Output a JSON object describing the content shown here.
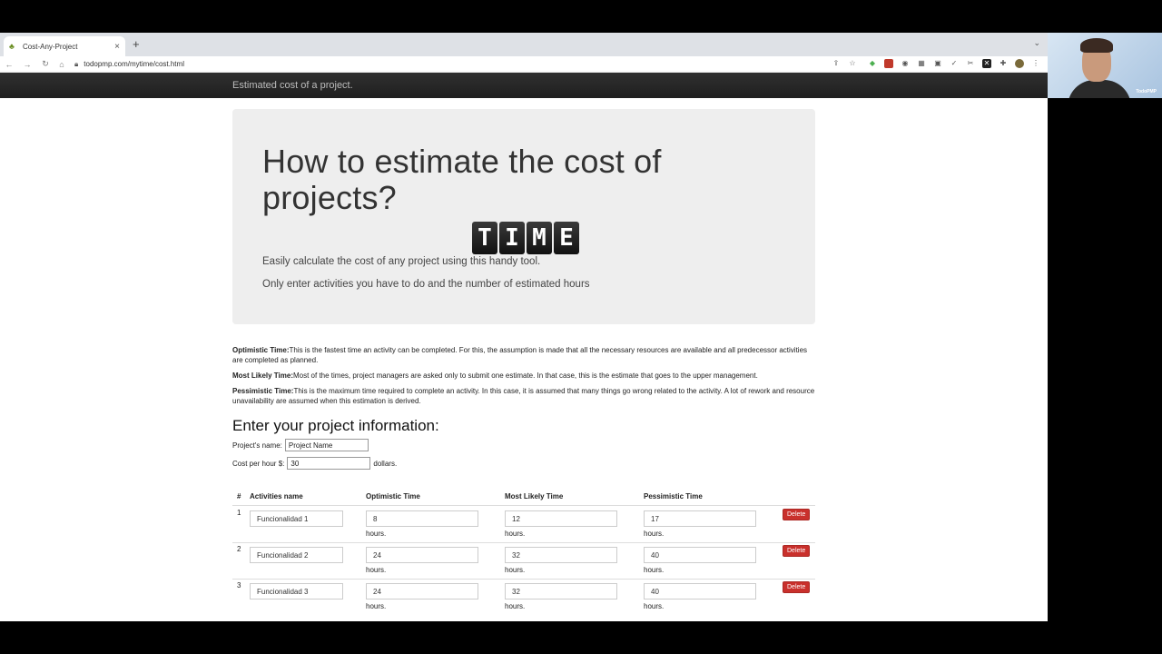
{
  "browser": {
    "tab_title": "Cost-Any-Project",
    "url": "todopmp.com/mytime/cost.html"
  },
  "navbar": {
    "brand": "Estimated cost of a project."
  },
  "hero": {
    "title": "How to estimate the cost of projects?",
    "logo_letters": [
      "T",
      "I",
      "M",
      "E"
    ],
    "line1": "Easily calculate the cost of any project using this handy tool.",
    "line2": "Only enter activities you have to do and the number of estimated hours"
  },
  "definitions": [
    {
      "term": "Optimistic Time:",
      "text": "This is the fastest time an activity can be completed. For this, the assumption is made that all the necessary resources are available and all predecessor activities are completed as planned."
    },
    {
      "term": "Most Likely Time:",
      "text": "Most of the times, project managers are asked only to submit one estimate. In that case, this is the estimate that goes to the upper management."
    },
    {
      "term": "Pessimistic Time:",
      "text": "This is the maximum time required to complete an activity. In this case, it is assumed that many things go wrong related to the activity. A lot of rework and resource unavailability are assumed when this estimation is derived."
    }
  ],
  "form": {
    "title": "Enter your project information:",
    "name_label": "Project's name:",
    "name_value": "Project Name",
    "cost_label": "Cost per hour $:",
    "cost_value": "30",
    "cost_suffix": "dollars."
  },
  "table": {
    "headers": {
      "num": "#",
      "name": "Activities name",
      "opt": "Optimistic Time",
      "ml": "Most Likely Time",
      "pes": "Pessimistic Time"
    },
    "hours_label": "hours.",
    "delete_label": "Delete",
    "rows": [
      {
        "num": "1",
        "name": "Funcionalidad 1",
        "opt": "8",
        "ml": "12",
        "pes": "17"
      },
      {
        "num": "2",
        "name": "Funcionalidad 2",
        "opt": "24",
        "ml": "32",
        "pes": "40"
      },
      {
        "num": "3",
        "name": "Funcionalidad 3",
        "opt": "24",
        "ml": "32",
        "pes": "40"
      }
    ]
  },
  "webcam": {
    "brand": "TodoPMP"
  }
}
